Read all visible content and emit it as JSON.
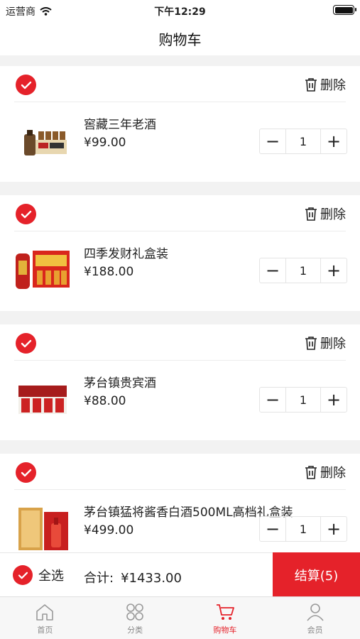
{
  "status_bar": {
    "carrier": "运营商",
    "time": "下午12:29"
  },
  "nav": {
    "title": "购物车"
  },
  "colors": {
    "accent": "#e5222a"
  },
  "cart": {
    "delete_label": "删除",
    "items": [
      {
        "name": "窖藏三年老酒",
        "price": "¥99.00",
        "quantity": "1",
        "checked": true
      },
      {
        "name": "四季发财礼盒装",
        "price": "¥188.00",
        "quantity": "1",
        "checked": true
      },
      {
        "name": "茅台镇贵宾酒",
        "price": "¥88.00",
        "quantity": "1",
        "checked": true
      },
      {
        "name": "茅台镇猛将酱香白酒500ML高档礼盒装",
        "price": "¥499.00",
        "quantity": "1",
        "checked": true
      }
    ]
  },
  "checkout": {
    "select_all": "全选",
    "total_label": "合计:",
    "total_amount": "¥1433.00",
    "button": "结算(5)"
  },
  "tabbar": [
    {
      "label": "首页",
      "icon": "home-icon",
      "active": false
    },
    {
      "label": "分类",
      "icon": "category-icon",
      "active": false
    },
    {
      "label": "购物车",
      "icon": "cart-icon",
      "active": true
    },
    {
      "label": "会员",
      "icon": "user-icon",
      "active": false
    }
  ]
}
